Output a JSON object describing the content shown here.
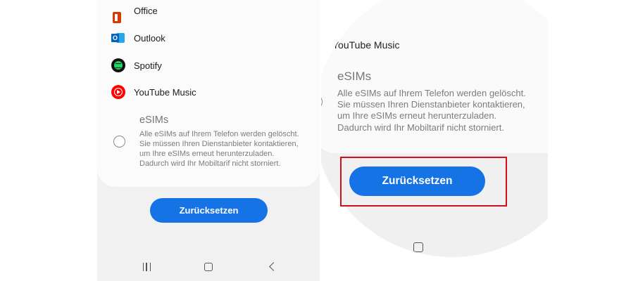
{
  "apps": [
    {
      "label": "Office",
      "icon": "office-icon"
    },
    {
      "label": "Outlook",
      "icon": "outlook-icon"
    },
    {
      "label": "Spotify",
      "icon": "spotify-icon"
    },
    {
      "label": "YouTube Music",
      "icon": "youtube-music-icon"
    }
  ],
  "esims": {
    "title": "eSIMs",
    "description": "Alle eSIMs auf Ihrem Telefon werden gelöscht. Sie müssen Ihren Dienstanbieter kontaktieren, um Ihre eSIMs erneut herunterzuladen. Dadurch wird Ihr Mobiltarif nicht storniert."
  },
  "reset_button": "Zurücksetzen",
  "zoom": {
    "app_label": "YouTube Music"
  },
  "colors": {
    "accent": "#1673e6",
    "highlight": "#d40f1b"
  }
}
